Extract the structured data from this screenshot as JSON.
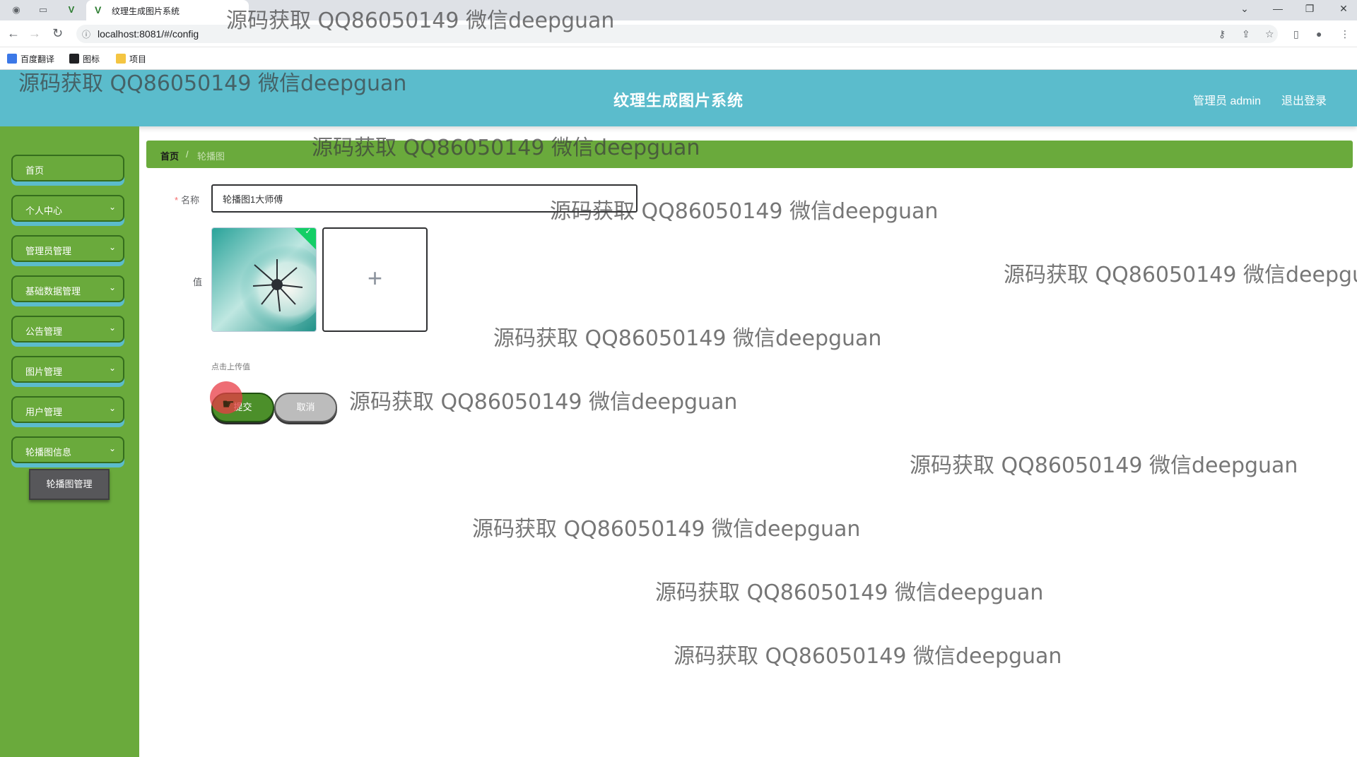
{
  "browser": {
    "tab_title": "纹理生成图片系统",
    "url": "localhost:8081/#/config",
    "bookmarks": [
      "百度翻译",
      "图标",
      "项目"
    ]
  },
  "header": {
    "title": "纹理生成图片系统",
    "user": "管理员 admin",
    "logout": "退出登录"
  },
  "sidebar": {
    "items": [
      {
        "label": "首页",
        "has_children": false
      },
      {
        "label": "个人中心",
        "has_children": true
      },
      {
        "label": "管理员管理",
        "has_children": true
      },
      {
        "label": "基础数据管理",
        "has_children": true
      },
      {
        "label": "公告管理",
        "has_children": true
      },
      {
        "label": "图片管理",
        "has_children": true
      },
      {
        "label": "用户管理",
        "has_children": true
      },
      {
        "label": "轮播图信息",
        "has_children": true
      }
    ],
    "submenu": {
      "label": "轮播图管理"
    }
  },
  "breadcrumb": {
    "home": "首页",
    "separator": "/",
    "current": "轮播图"
  },
  "form": {
    "name_label": "名称",
    "name_value": "轮播图1大师傅",
    "value_label": "值",
    "upload_hint": "点击上传值",
    "submit_label": "提交",
    "cancel_label": "取消"
  },
  "watermark": "源码获取 QQ86050149 微信deepguan",
  "colors": {
    "header_bg": "#5bbccc",
    "sidebar_bg": "#6aaa3c",
    "breadcrumb_bg": "#6aaa3c",
    "submit_bg": "#4c8f2a",
    "cancel_bg": "#bcbcbc"
  }
}
